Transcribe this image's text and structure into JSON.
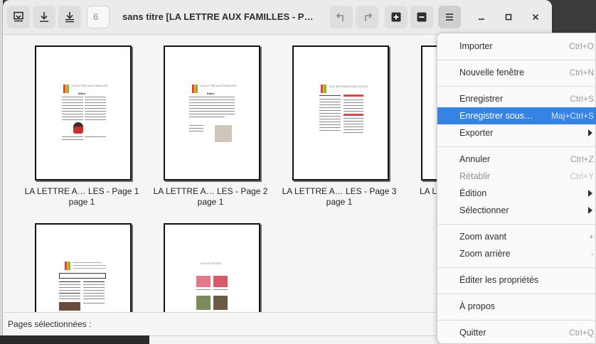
{
  "window": {
    "title": "sans titre [LA LETTRE AUX FAMILLES - Page 1, L…",
    "page_number": "6",
    "status_label": "Pages sélectionnées :"
  },
  "toolbar": {
    "icons": [
      "insert-page-icon",
      "download-icon",
      "export-all-icon",
      "undo-icon",
      "redo-icon",
      "zoom-in-icon",
      "zoom-out-icon",
      "hamburger-menu-icon",
      "minimize-icon",
      "maximize-icon",
      "close-icon"
    ]
  },
  "pages": [
    {
      "name": "LA LETTRE A… LES - Page 1",
      "sub": "page 1"
    },
    {
      "name": "LA LETTRE A… LES - Page 2",
      "sub": "page 1"
    },
    {
      "name": "LA LETTRE A… LES - Page 3",
      "sub": "page 1"
    },
    {
      "name": "LA L",
      "sub": ""
    },
    {
      "name": "",
      "sub": ""
    },
    {
      "name": "",
      "sub": ""
    }
  ],
  "page_content": {
    "p1_header": "LA LETTRE AUX FAMILLES",
    "p1_title": "Edito",
    "p2_title": "Edito",
    "p3_header": "LES INFORMATIONS UTILES",
    "p6_header": "LES ACTIVITES"
  },
  "menu": {
    "items": [
      {
        "label": "Importer",
        "accel": "Ctrl+O"
      },
      {
        "label": "Nouvelle fenêtre",
        "accel": "Ctrl+N"
      },
      {
        "label": "Enregistrer",
        "accel": "Ctrl+S"
      },
      {
        "label": "Enregistrer sous…",
        "accel": "Maj+Ctrl+S"
      },
      {
        "label": "Exporter",
        "accel": ""
      },
      {
        "label": "Annuler",
        "accel": "Ctrl+Z"
      },
      {
        "label": "Rétablir",
        "accel": "Ctrl+Y"
      },
      {
        "label": "Édition",
        "accel": ""
      },
      {
        "label": "Sélectionner",
        "accel": ""
      },
      {
        "label": "Zoom avant",
        "accel": "+"
      },
      {
        "label": "Zoom arrière",
        "accel": "-"
      },
      {
        "label": "Éditer les propriétés",
        "accel": ""
      },
      {
        "label": "À propos",
        "accel": ""
      },
      {
        "label": "Quitter",
        "accel": "Ctrl+Q"
      }
    ],
    "selected_index": 3
  },
  "colors": {
    "accent": "#3584e4",
    "window_bg": "#f6f5f4",
    "headerbar": "#ebebeb"
  }
}
